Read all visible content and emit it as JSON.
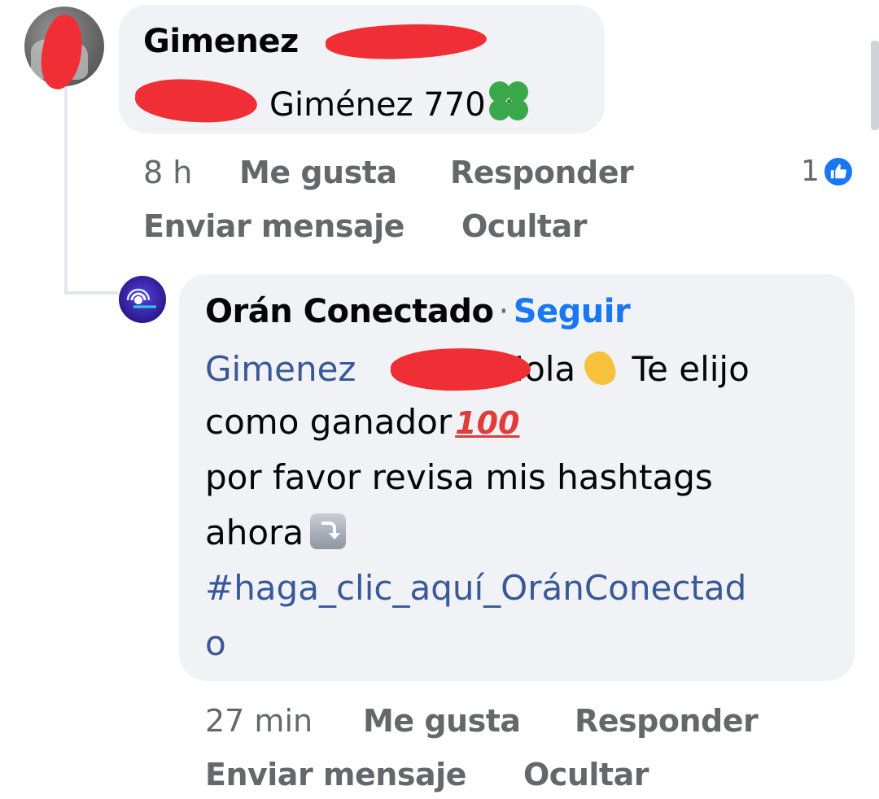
{
  "comment": {
    "author": "Gimenez",
    "text_visible": "Giménez 770",
    "clover_emoji": "clover-icon",
    "time": "8 h",
    "actions": {
      "like": "Me gusta",
      "reply": "Responder",
      "send_message": "Enviar mensaje",
      "hide": "Ocultar"
    },
    "reaction_count": "1"
  },
  "reply": {
    "author": "Orán Conectado",
    "separator": "·",
    "follow": "Seguir",
    "mention": "Gimenez",
    "line1_rest": "Hola",
    "line1_tail": "Te elijo",
    "line2": "como ganador",
    "line3": "por favor revisa mis hashtags",
    "line4": "ahora",
    "hashtag_line1": "#haga_clic_aquí_OránConectad",
    "hashtag_line2": "o",
    "time": "27 min",
    "actions": {
      "like": "Me gusta",
      "reply": "Responder",
      "send_message": "Enviar mensaje",
      "hide": "Ocultar"
    }
  },
  "colors": {
    "bubble": "#f0f2f5",
    "link": "#385898",
    "accent": "#1877f2",
    "meta": "#65676b",
    "redaction": "#ef2f35"
  }
}
